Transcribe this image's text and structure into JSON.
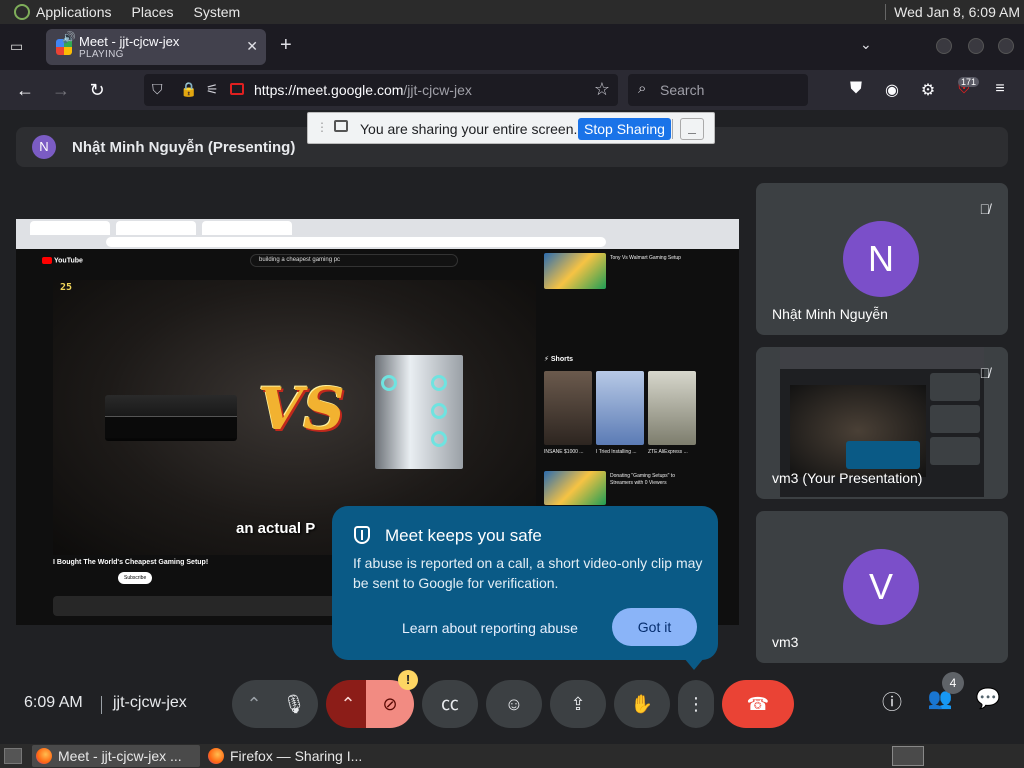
{
  "topbar": {
    "applications": "Applications",
    "places": "Places",
    "system": "System",
    "clock": "Wed Jan  8,  6:09 AM"
  },
  "browser": {
    "tab_title": "Meet - jjt-cjcw-jex",
    "tab_status": "PLAYING",
    "url_host": "https://meet.google.com",
    "url_path": "/jjt-cjcw-jex",
    "search_placeholder": "Search",
    "extension_badge": "171"
  },
  "meet": {
    "presenter_initial": "N",
    "presenter_label": "Nhật Minh Nguyễn (Presenting)",
    "share_message": "You are sharing your entire screen.",
    "stop_sharing": "Stop Sharing",
    "tooltip": {
      "title": "Meet keeps you safe",
      "body": "If abuse is reported on a call, a short video-only clip may be sent to Google for verification.",
      "learn_link": "Learn about reporting abuse",
      "button": "Got it"
    },
    "participants": [
      {
        "initial": "N",
        "name": "Nhật Minh Nguyễn"
      },
      {
        "initial": "",
        "name": "vm3 (Your Presentation)"
      },
      {
        "initial": "V",
        "name": "vm3"
      }
    ],
    "time": "6:09 AM",
    "meeting_code": "jjt-cjcw-jex",
    "participant_count": "4",
    "warning_mark": "!"
  },
  "shared_screen": {
    "yt_logo": "YouTube",
    "yt_query": "building a cheapest gaming pc",
    "counter": "25",
    "vs_text": "VS",
    "caption": "an actual P",
    "video_title": "I Bought The World's Cheapest Gaming Setup!",
    "subscribe": "Subscribe",
    "shorts_label": "Shorts",
    "side_videos": [
      "Tony Vs Walmart Gaming Setup",
      "Donating \"Gaming Setups\" to Streamers with 0 Viewers"
    ],
    "shorts": [
      "INSANE $1000 ...",
      "I Tried Installing ...",
      "ZTE AliExpress ..."
    ]
  },
  "taskbar": {
    "items": [
      "Meet - jjt-cjcw-jex ...",
      "Firefox — Sharing I..."
    ]
  }
}
